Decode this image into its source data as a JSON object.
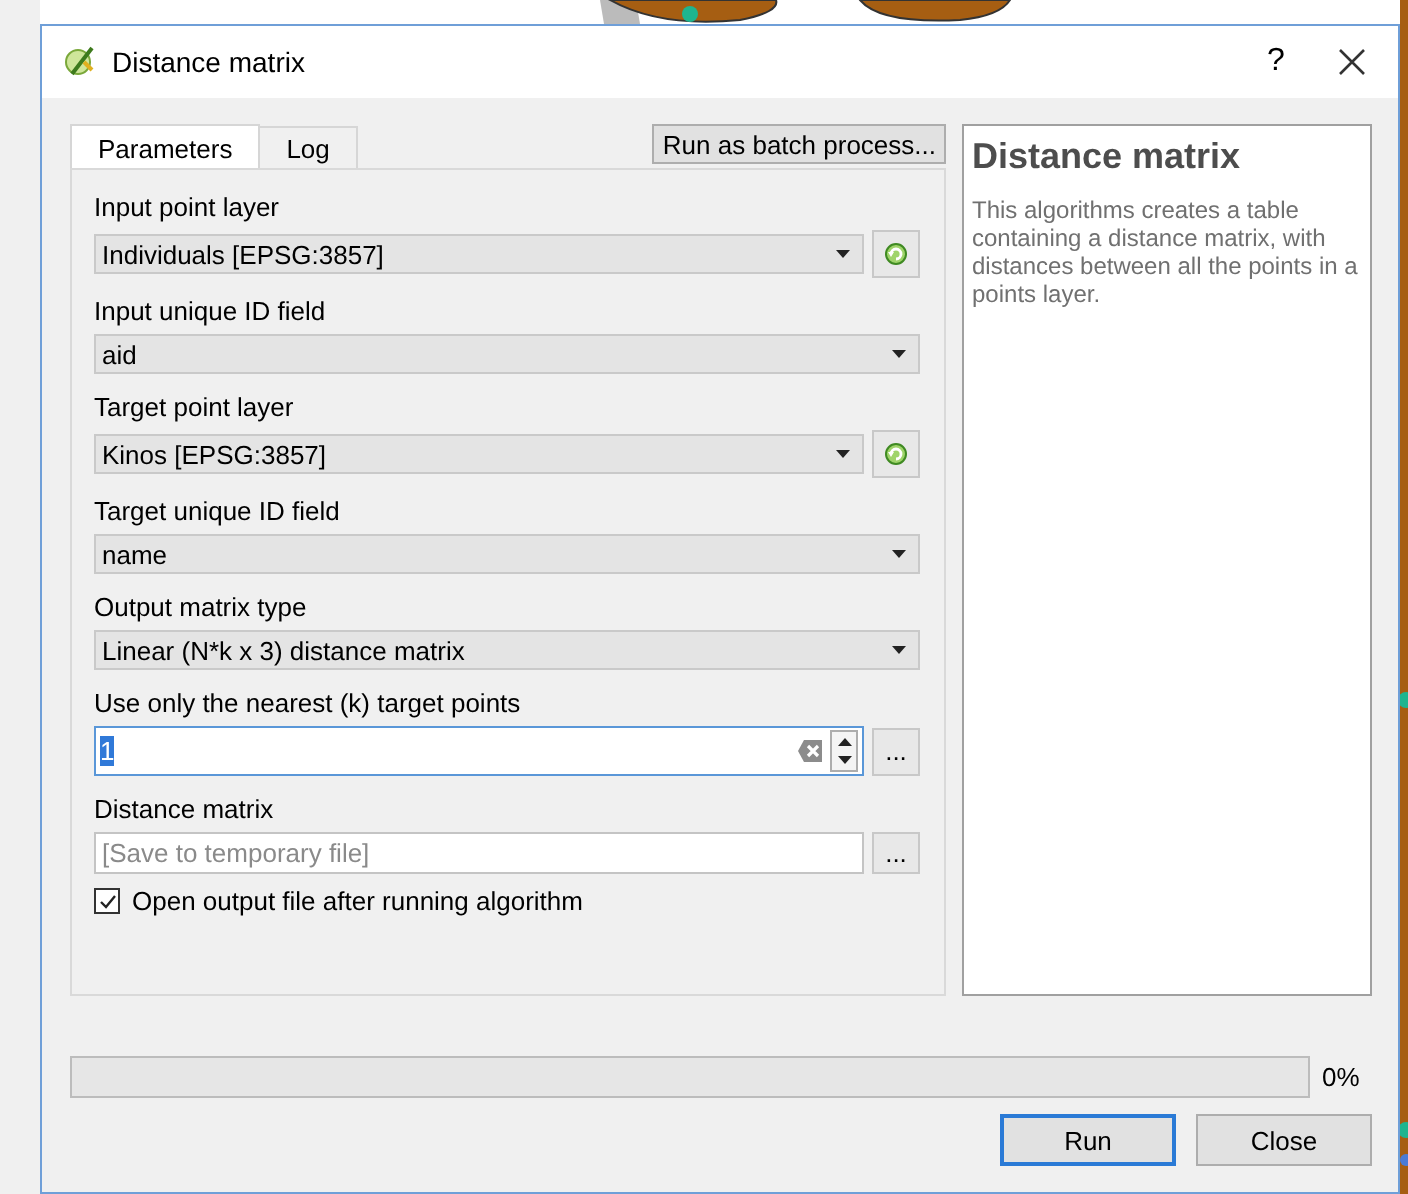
{
  "window": {
    "title": "Distance matrix",
    "help_button": "?"
  },
  "tabs": [
    {
      "label": "Parameters",
      "selected": true
    },
    {
      "label": "Log",
      "selected": false
    }
  ],
  "batch_button": "Run as batch process...",
  "parameters": [
    {
      "kind": "layer",
      "label": "Input point layer",
      "value": "Individuals [EPSG:3857]"
    },
    {
      "kind": "combo",
      "label": "Input unique ID field",
      "value": "aid"
    },
    {
      "kind": "layer",
      "label": "Target point layer",
      "value": "Kinos [EPSG:3857]"
    },
    {
      "kind": "combo",
      "label": "Target unique ID field",
      "value": "name"
    },
    {
      "kind": "combo",
      "label": "Output matrix type",
      "value": "Linear (N*k x 3) distance matrix"
    },
    {
      "kind": "spin",
      "label": "Use only the nearest (k) target points",
      "value": "1",
      "text_selected": true,
      "more_button": "..."
    },
    {
      "kind": "file",
      "label": "Distance matrix",
      "placeholder": "[Save to temporary file]",
      "more_button": "..."
    },
    {
      "kind": "checkbox",
      "label": "Open output file after running algorithm",
      "checked": true
    }
  ],
  "help": {
    "title": "Distance matrix",
    "text": "This algorithms creates a table containing a distance matrix, with distances between all the points in a points layer."
  },
  "progress": {
    "level": 0,
    "reading": "0%"
  },
  "buttons": [
    {
      "label": "Run",
      "default": true
    },
    {
      "label": "Close",
      "default": false
    }
  ]
}
